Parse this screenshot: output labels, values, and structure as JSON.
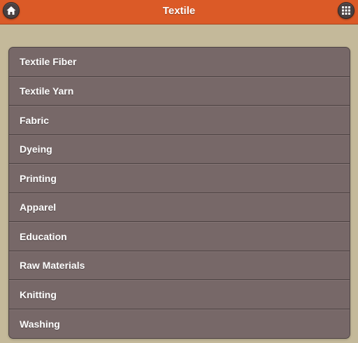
{
  "header": {
    "title": "Textile",
    "home_icon": "home-icon",
    "grid_icon": "grid-icon"
  },
  "menu": {
    "items": [
      {
        "label": "Textile Fiber"
      },
      {
        "label": "Textile Yarn"
      },
      {
        "label": "Fabric"
      },
      {
        "label": "Dyeing"
      },
      {
        "label": "Printing"
      },
      {
        "label": "Apparel"
      },
      {
        "label": "Education"
      },
      {
        "label": "Raw Materials"
      },
      {
        "label": "Knitting"
      },
      {
        "label": "Washing"
      }
    ]
  },
  "colors": {
    "header_bg": "#db5a27",
    "page_bg": "#c4b99a",
    "list_bg": "#776868",
    "text": "#ffffff"
  }
}
